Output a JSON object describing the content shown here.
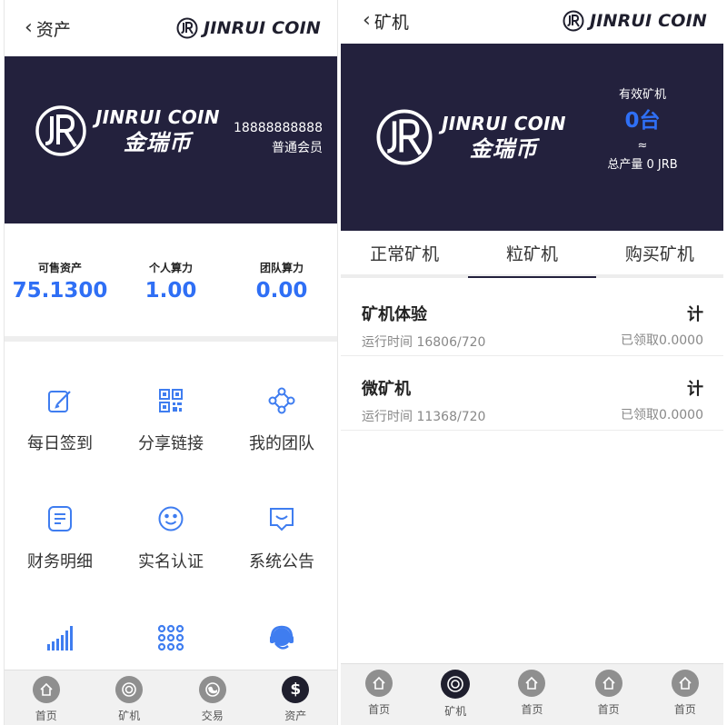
{
  "assets_screen": {
    "header": {
      "back_label": "资产",
      "brand": "JINRUI COIN"
    },
    "banner": {
      "logo_en": "JINRUI COIN",
      "logo_cn": "金瑞币",
      "phone": "18888888888",
      "member_level": "普通会员"
    },
    "stats": [
      {
        "label": "可售资产",
        "value": "75.1300"
      },
      {
        "label": "个人算力",
        "value": "1.00"
      },
      {
        "label": "团队算力",
        "value": "0.00"
      }
    ],
    "menu": [
      {
        "label": "每日签到",
        "icon": "edit-icon"
      },
      {
        "label": "分享链接",
        "icon": "qrcode-icon"
      },
      {
        "label": "我的团队",
        "icon": "team-icon"
      },
      {
        "label": "财务明细",
        "icon": "document-icon"
      },
      {
        "label": "实名认证",
        "icon": "smiley-icon"
      },
      {
        "label": "系统公告",
        "icon": "message-icon"
      },
      {
        "label": "",
        "icon": "bar-chart-icon"
      },
      {
        "label": "",
        "icon": "dots-grid-icon"
      },
      {
        "label": "",
        "icon": "headset-icon"
      }
    ],
    "bottom_nav": [
      {
        "label": "首页",
        "icon": "home-icon"
      },
      {
        "label": "矿机",
        "icon": "miner-icon"
      },
      {
        "label": "交易",
        "icon": "trade-icon"
      },
      {
        "label": "资产",
        "icon": "dollar-icon"
      }
    ],
    "colors": {
      "banner": "#23213d",
      "accent": "#2f6ff5"
    }
  },
  "miner_screen": {
    "header": {
      "back_label": "矿机",
      "brand": "JINRUI COIN"
    },
    "banner": {
      "logo_en": "JINRUI COIN",
      "logo_cn": "金瑞币",
      "valid_label": "有效矿机",
      "valid_count": "0台",
      "approx": "≈",
      "total_output": "总产量 0 JRB"
    },
    "tabs": [
      "正常矿机",
      "粒矿机",
      "购买矿机"
    ],
    "active_tab": "粒矿机",
    "miners": [
      {
        "name": "矿机体验",
        "runtime": "运行时间 16806/720",
        "unit": "计",
        "claimed": "已领取0.0000"
      },
      {
        "name": "微矿机",
        "runtime": "运行时间 11368/720",
        "unit": "计",
        "claimed": "已领取0.0000"
      }
    ],
    "bottom_nav": [
      {
        "label": "首页",
        "icon": "home-icon"
      },
      {
        "label": "矿机",
        "icon": "miner-icon"
      },
      {
        "label": "首页",
        "icon": "home-icon"
      },
      {
        "label": "首页",
        "icon": "home-icon"
      },
      {
        "label": "首页",
        "icon": "home-icon"
      }
    ]
  }
}
